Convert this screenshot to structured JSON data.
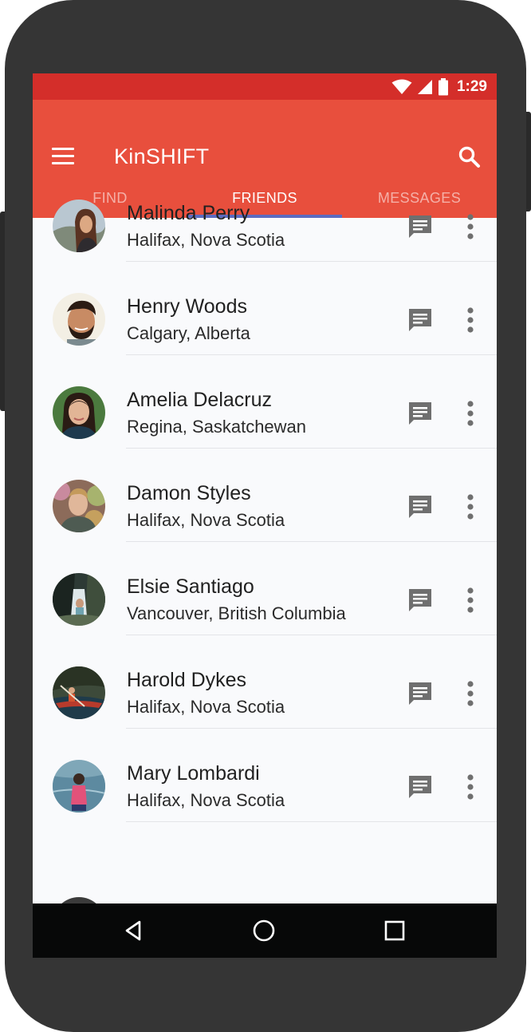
{
  "status_bar": {
    "time": "1:29"
  },
  "app_bar": {
    "title": "KinSHIFT"
  },
  "tabs": [
    {
      "label": "FIND",
      "active": false
    },
    {
      "label": "FRIENDS",
      "active": true
    },
    {
      "label": "MESSAGES",
      "active": false
    }
  ],
  "friends": [
    {
      "name": "Malinda Perry",
      "location": "Halifax, Nova Scotia"
    },
    {
      "name": "Henry Woods",
      "location": "Calgary, Alberta"
    },
    {
      "name": "Amelia Delacruz",
      "location": "Regina, Saskatchewan"
    },
    {
      "name": "Damon Styles",
      "location": "Halifax, Nova Scotia"
    },
    {
      "name": "Elsie Santiago",
      "location": "Vancouver, British Columbia"
    },
    {
      "name": "Harold Dykes",
      "location": "Halifax, Nova Scotia"
    },
    {
      "name": "Mary Lombardi",
      "location": "Halifax, Nova Scotia"
    }
  ],
  "colors": {
    "status_bar": "#d42e2a",
    "app_bar": "#e84f3d",
    "tab_indicator": "#5c6bc0",
    "icon_grey": "#6f6f6f"
  },
  "icons": {
    "menu": "menu-icon",
    "search": "search-icon",
    "wifi": "wifi-icon",
    "signal": "signal-icon",
    "battery": "battery-icon",
    "message": "message-icon",
    "more": "more-vert-icon",
    "back": "back-icon",
    "home": "home-icon",
    "recents": "recents-icon"
  }
}
